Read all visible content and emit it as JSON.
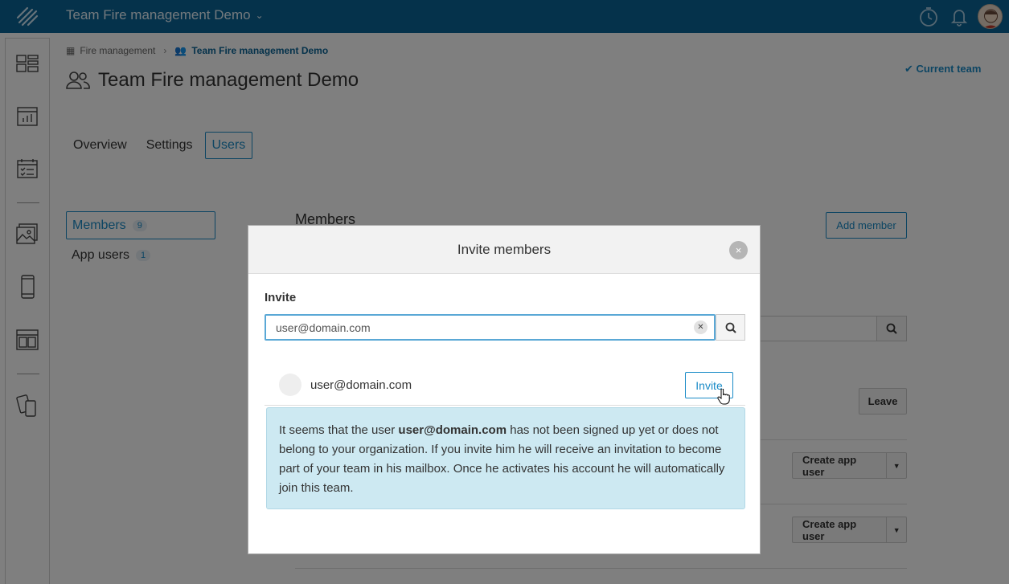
{
  "header": {
    "app_title": "Team Fire management Demo"
  },
  "breadcrumb": {
    "parent": "Fire management",
    "current": "Team Fire management Demo"
  },
  "page": {
    "title": "Team Fire management Demo",
    "current_team_label": "Current team"
  },
  "tabs": [
    {
      "label": "Overview"
    },
    {
      "label": "Settings"
    },
    {
      "label": "Users"
    }
  ],
  "left_nav": [
    {
      "label": "Members",
      "count": "9"
    },
    {
      "label": "App users",
      "count": "1"
    }
  ],
  "background": {
    "heading": "Members",
    "add_member": "Add member",
    "leave": "Leave",
    "create_app_user": "Create app user"
  },
  "modal": {
    "title": "Invite members",
    "close_symbol": "×",
    "invite_label": "Invite",
    "input_value": "user@domain.com",
    "result_email": "user@domain.com",
    "invite_button": "Invite",
    "info_prefix": "It seems that the user ",
    "info_email": "user@domain.com",
    "info_suffix": " has not been signed up yet or does not belong to your organization. If you invite him he will receive an invitation to become part of your team in his mailbox. Once he activates his account he will automatically join this team."
  }
}
